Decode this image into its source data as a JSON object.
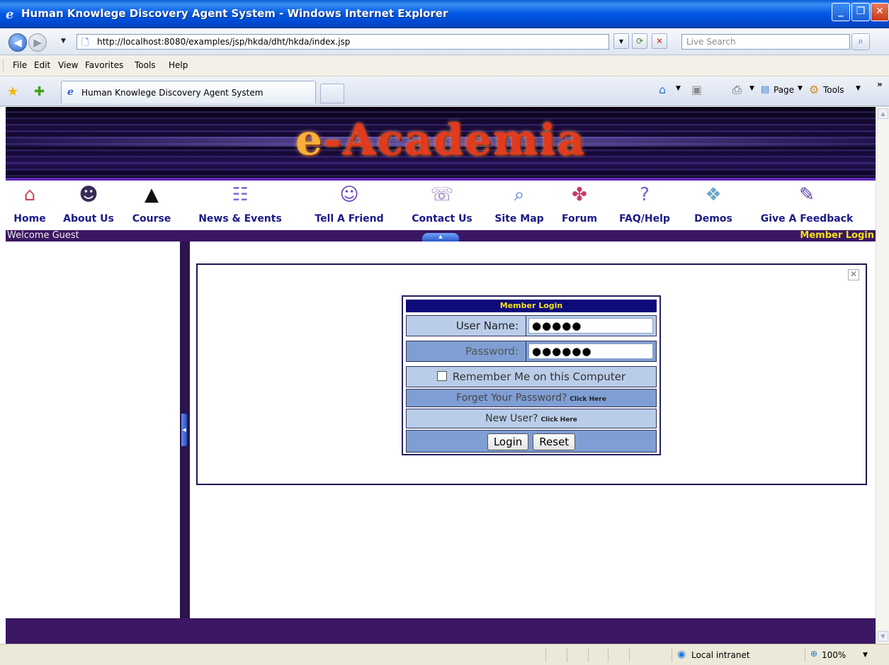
{
  "window": {
    "title": "Human Knowlege Discovery Agent System - Windows Internet Explorer",
    "minimize": "_",
    "maximize": "❐",
    "close": "✕"
  },
  "address_bar": {
    "url": "http://localhost:8080/examples/jsp/hkda/dht/hkda/index.jsp",
    "search_placeholder": "Live Search"
  },
  "menu": [
    "File",
    "Edit",
    "View",
    "Favorites",
    "Tools",
    "Help"
  ],
  "tab": {
    "label": "Human Knowlege Discovery Agent System"
  },
  "command_bar": {
    "page": "Page",
    "tools": "Tools"
  },
  "site": {
    "banner_prefix": "e",
    "banner_rest": "-Academia",
    "nav": [
      {
        "label": "Home",
        "icon": "house-icon",
        "color": "#c7485a"
      },
      {
        "label": "About Us",
        "icon": "people-icon",
        "color": "#3a2a5a"
      },
      {
        "label": "Course",
        "icon": "graduation-cap-icon",
        "color": "#111111"
      },
      {
        "label": "News & Events",
        "icon": "newspaper-icon",
        "color": "#7a6ad6"
      },
      {
        "label": "Tell A Friend",
        "icon": "friends-icon",
        "color": "#6a48b8"
      },
      {
        "label": "Contact Us",
        "icon": "phone-icon",
        "color": "#8a6ab8"
      },
      {
        "label": "Site Map",
        "icon": "magnifier-icon",
        "color": "#4a7ad8"
      },
      {
        "label": "Forum",
        "icon": "forum-icon",
        "color": "#c83a6a"
      },
      {
        "label": "FAQ/Help",
        "icon": "help-icon",
        "color": "#7a5ac8"
      },
      {
        "label": "Demos",
        "icon": "demos-icon",
        "color": "#6aa8c8"
      },
      {
        "label": "Give A Feedback",
        "icon": "feedback-icon",
        "color": "#5a3aa8"
      }
    ],
    "welcome": "Welcome Guest",
    "member_login_link": "Member Login"
  },
  "login": {
    "header": "Member Login",
    "username_label": "User Name:",
    "username_value": "●●●●●",
    "password_label": "Password:",
    "password_value": "●●●●●●",
    "remember": "Remember Me on this Computer",
    "forgot": "Forget Your Password?",
    "forgot_link": "Click Here",
    "new_user": "New User?",
    "new_user_link": "Click Here",
    "login_button": "Login",
    "reset_button": "Reset"
  },
  "status_bar": {
    "zone": "Local intranet",
    "zoom": "100%"
  },
  "colors": {
    "banner_text": "#e23a1e",
    "nav_text": "#1a1a86",
    "bar_purple": "#3b1763",
    "login_header": "#0d0a7a"
  }
}
